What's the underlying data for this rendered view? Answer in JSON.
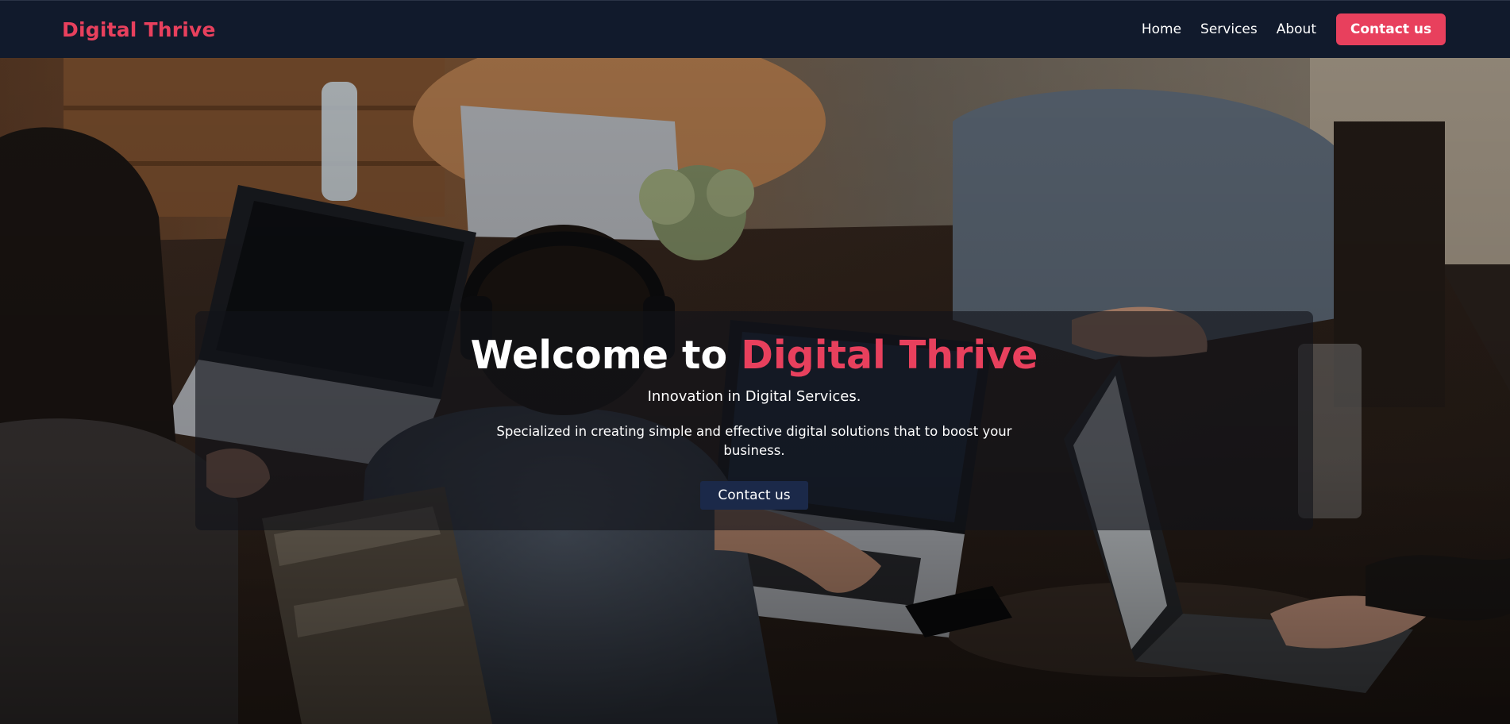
{
  "brand": {
    "name": "Digital Thrive",
    "color": "#e8405d"
  },
  "nav": {
    "links": [
      {
        "label": "Home"
      },
      {
        "label": "Services"
      },
      {
        "label": "About"
      }
    ],
    "cta_label": "Contact us"
  },
  "hero": {
    "title_prefix": "Welcome to ",
    "title_accent": "Digital Thrive",
    "subtitle": "Innovation in Digital Services.",
    "description": "Specialized in creating simple and effective digital solutions that to boost your business.",
    "cta_label": "Contact us",
    "background_image": "team-working-on-laptops-photo"
  },
  "colors": {
    "navbar_bg": "#111a2c",
    "accent": "#e8405d",
    "hero_button_bg": "#1b2949"
  }
}
